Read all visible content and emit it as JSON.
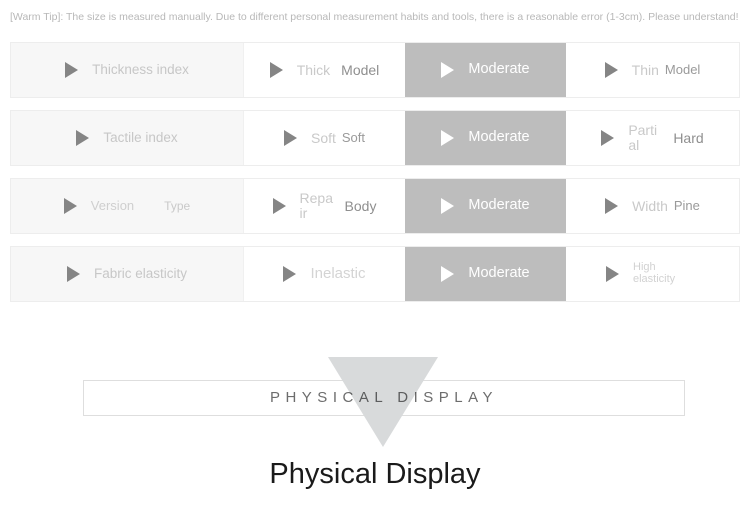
{
  "warm_tip": {
    "text": "[Warm Tip]: The size is measured manually. Due to different personal measurement habits and tools, there is a reasonable error (1-3cm). Please understand!"
  },
  "colors": {
    "selected_bg": "#bdbdbd",
    "label_bg": "#f7f7f7",
    "row_border": "#ededed",
    "triangle_fill": "#d8dadb",
    "bullet": "#858585"
  },
  "spec_table": {
    "rows": [
      {
        "label": {
          "primary": "Thickness index",
          "secondary": ""
        },
        "options": [
          {
            "primary": "Thick",
            "secondary": "Model",
            "selected": false
          },
          {
            "primary": "Moderate",
            "secondary": "",
            "selected": true
          },
          {
            "primary": "Thin",
            "secondary": "Model",
            "selected": false
          }
        ]
      },
      {
        "label": {
          "primary": "Tactile index",
          "secondary": ""
        },
        "options": [
          {
            "primary": "Soft",
            "secondary": "Soft",
            "selected": false
          },
          {
            "primary": "Moderate",
            "secondary": "",
            "selected": true
          },
          {
            "primary": "Partial",
            "secondary": "Hard",
            "selected": false
          }
        ]
      },
      {
        "label": {
          "primary": "Version",
          "secondary": "Type"
        },
        "options": [
          {
            "primary": "Repair",
            "secondary": "Body",
            "selected": false
          },
          {
            "primary": "Moderate",
            "secondary": "",
            "selected": true
          },
          {
            "primary": "Width",
            "secondary": "Pine",
            "selected": false
          }
        ]
      },
      {
        "label": {
          "primary": "Fabric elasticity",
          "secondary": ""
        },
        "options": [
          {
            "primary": "Inelastic",
            "secondary": "",
            "selected": false
          },
          {
            "primary": "Moderate",
            "secondary": "",
            "selected": true
          },
          {
            "primary": "High elasticity",
            "secondary": "",
            "selected": false
          }
        ]
      }
    ]
  },
  "physical_display": {
    "banner_text": "PHYSICAL DISPLAY",
    "title": "Physical Display"
  }
}
